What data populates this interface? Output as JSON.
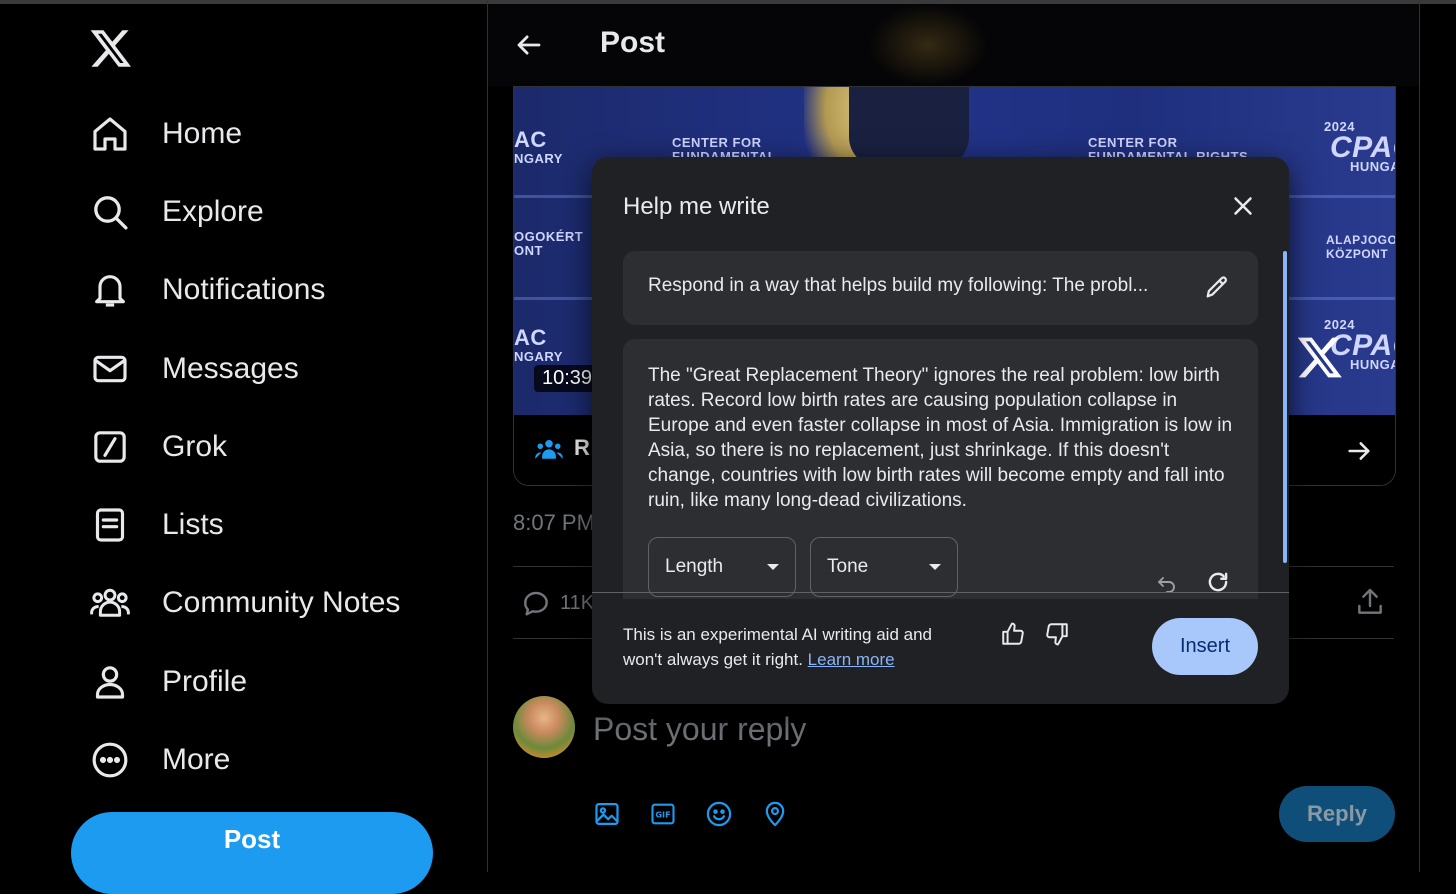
{
  "sidebar": {
    "logo_icon": "x-logo-icon",
    "items": [
      {
        "label": "Home",
        "icon": "home-icon"
      },
      {
        "label": "Explore",
        "icon": "search-icon"
      },
      {
        "label": "Notifications",
        "icon": "bell-icon"
      },
      {
        "label": "Messages",
        "icon": "envelope-icon"
      },
      {
        "label": "Grok",
        "icon": "grok-icon"
      },
      {
        "label": "Lists",
        "icon": "list-icon"
      },
      {
        "label": "Community Notes",
        "icon": "people-icon"
      },
      {
        "label": "Profile",
        "icon": "person-icon"
      },
      {
        "label": "More",
        "icon": "more-circle-icon"
      }
    ],
    "post_button": "Post"
  },
  "header": {
    "title": "Post",
    "back_icon": "back-arrow-icon"
  },
  "media": {
    "video_time": "10:39",
    "community_label": "R",
    "background_text": {
      "center_for_left": "CENTER FOR",
      "fundamental_left": "FUNDAMENTAL",
      "center_for_right": "CENTER FOR",
      "fundamental_right": "FUNDAMENTAL RIGHTS",
      "year_top": "2024",
      "cpac_top": "CPAC",
      "hungary_top": "HUNGA",
      "alapjogo": "ALAPJOGO",
      "kozpont": "KÖZPONT",
      "year_bottom": "2024",
      "cpac_bottom": "CPAC",
      "hungary_bottom": "HUNGA",
      "ac_left_top": "AC",
      "ngary_left_top": "NGARY",
      "ogokert": "OGOKÉRT",
      "ont": "ONT",
      "ac_left_bottom": "AC",
      "ngary_left_bottom": "NGARY"
    }
  },
  "post": {
    "timestamp": "8:07 PM",
    "reply_count": "11K"
  },
  "composer": {
    "placeholder": "Post your reply",
    "reply_button": "Reply",
    "icons": [
      "image-icon",
      "gif-icon",
      "emoji-icon",
      "location-icon"
    ]
  },
  "dialog": {
    "title": "Help me write",
    "prompt": "Respond in a way that helps build my following: The probl...",
    "response": "The \"Great Replacement Theory\" ignores the real problem: low birth rates. Record low birth rates are causing population collapse in Europe and even faster collapse in most of Asia. Immigration is low in Asia, so there is no replacement, just shrinkage. If this doesn't change, countries with low birth rates will become empty and fall into ruin, like many long-dead civilizations.",
    "length_label": "Length",
    "tone_label": "Tone",
    "disclaimer": "This is an experimental AI writing aid and won't always get it right.",
    "learn_more": "Learn more",
    "insert_button": "Insert"
  },
  "colors": {
    "accent": "#1d9bf0",
    "background": "#000000",
    "dialog_bg": "#202124",
    "insert_bg": "#a8c7fa"
  }
}
